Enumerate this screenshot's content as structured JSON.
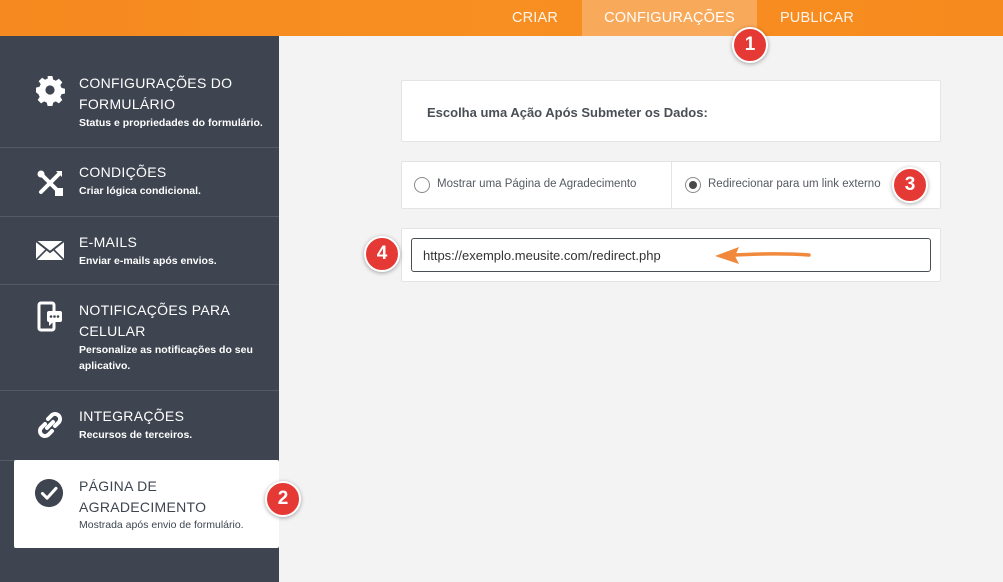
{
  "topbar": {
    "tabs": [
      {
        "label": "CRIAR"
      },
      {
        "label": "CONFIGURAÇÕES"
      },
      {
        "label": "PUBLICAR"
      }
    ]
  },
  "sidebar": {
    "items": [
      {
        "title_line1": "CONFIGURAÇÕES DO",
        "title_line2": "FORMULÁRIO",
        "subtitle": "Status e propriedades do formulário.",
        "icon": "gear-icon"
      },
      {
        "title_line1": "CONDIÇÕES",
        "subtitle": "Criar lógica condicional.",
        "icon": "conditions-icon"
      },
      {
        "title_line1": "E-MAILS",
        "subtitle": "Enviar e-mails após envios.",
        "icon": "envelope-icon"
      },
      {
        "title_line1": "NOTIFICAÇÕES PARA",
        "title_line2": "CELULAR",
        "subtitle_line1": "Personalize as notificações do seu",
        "subtitle_line2": "aplicativo.",
        "icon": "mobile-notification-icon"
      },
      {
        "title_line1": "INTEGRAÇÕES",
        "subtitle": "Recursos de terceiros.",
        "icon": "link-icon"
      },
      {
        "title_line1": "PÁGINA DE",
        "title_line2": "AGRADECIMENTO",
        "subtitle": "Mostrada após envio de formulário.",
        "icon": "checkmark-circle-icon"
      }
    ]
  },
  "main": {
    "action_title": "Escolha uma Ação Após Submeter os Dados:",
    "options": [
      {
        "label": "Mostrar uma Página de Agradecimento",
        "selected": false
      },
      {
        "label": "Redirecionar para um link externo",
        "selected": true
      }
    ],
    "url_value": "https://exemplo.meusite.com/redirect.php"
  },
  "annotations": {
    "badges": [
      "1",
      "2",
      "3",
      "4"
    ],
    "badge_color": "#e53935",
    "arrow_color": "#f0893c"
  },
  "colors": {
    "accent": "#f78a1e",
    "sidebar_bg": "#3e4550"
  }
}
